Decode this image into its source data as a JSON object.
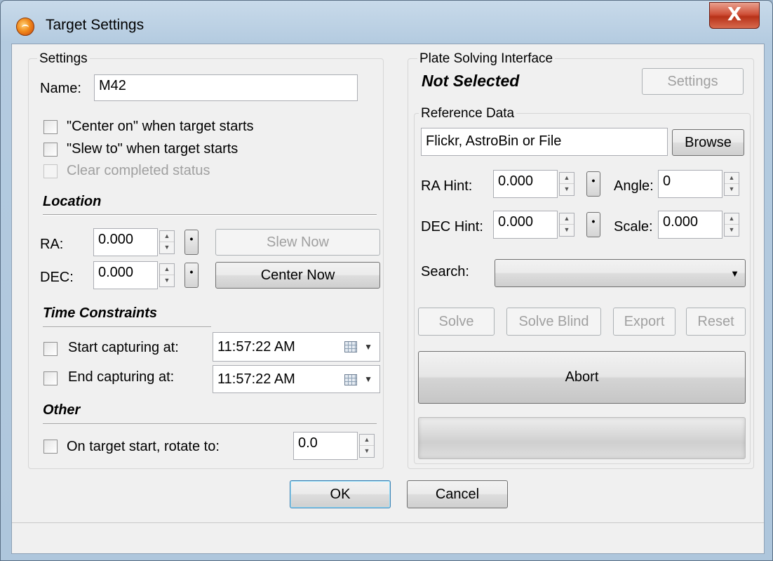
{
  "window": {
    "title": "Target Settings",
    "app_icon": "sun-icon",
    "close_label": "X"
  },
  "settings": {
    "legend": "Settings",
    "name_label": "Name:",
    "name_value": "M42",
    "center_on_label": "\"Center on\" when target starts",
    "slew_to_label": "\"Slew to\" when target starts",
    "clear_completed_label": "Clear completed status",
    "location_heading": "Location",
    "ra_label": "RA:",
    "ra_value": "0.000",
    "dec_label": "DEC:",
    "dec_value": "0.000",
    "slew_now_label": "Slew Now",
    "center_now_label": "Center Now",
    "time_heading": "Time Constraints",
    "start_label": "Start capturing at:",
    "start_value": "11:57:22 AM",
    "end_label": "End capturing at:",
    "end_value": "11:57:22 AM",
    "other_heading": "Other",
    "rotate_label": "On target start, rotate to:",
    "rotate_value": "0.0"
  },
  "plate": {
    "legend": "Plate Solving Interface",
    "status": "Not Selected",
    "settings_label": "Settings"
  },
  "reference": {
    "legend": "Reference Data",
    "source_value": "Flickr, AstroBin or File",
    "browse_label": "Browse",
    "ra_hint_label": "RA Hint:",
    "ra_hint_value": "0.000",
    "angle_label": "Angle:",
    "angle_value": "0",
    "dec_hint_label": "DEC Hint:",
    "dec_hint_value": "0.000",
    "scale_label": "Scale:",
    "scale_value": "0.000",
    "search_label": "Search:",
    "search_value": "",
    "solve_label": "Solve",
    "solve_blind_label": "Solve Blind",
    "export_label": "Export",
    "reset_label": "Reset",
    "abort_label": "Abort",
    "progress": 0
  },
  "footer": {
    "ok_label": "OK",
    "cancel_label": "Cancel",
    "status_text": ""
  },
  "dot_label": "•"
}
